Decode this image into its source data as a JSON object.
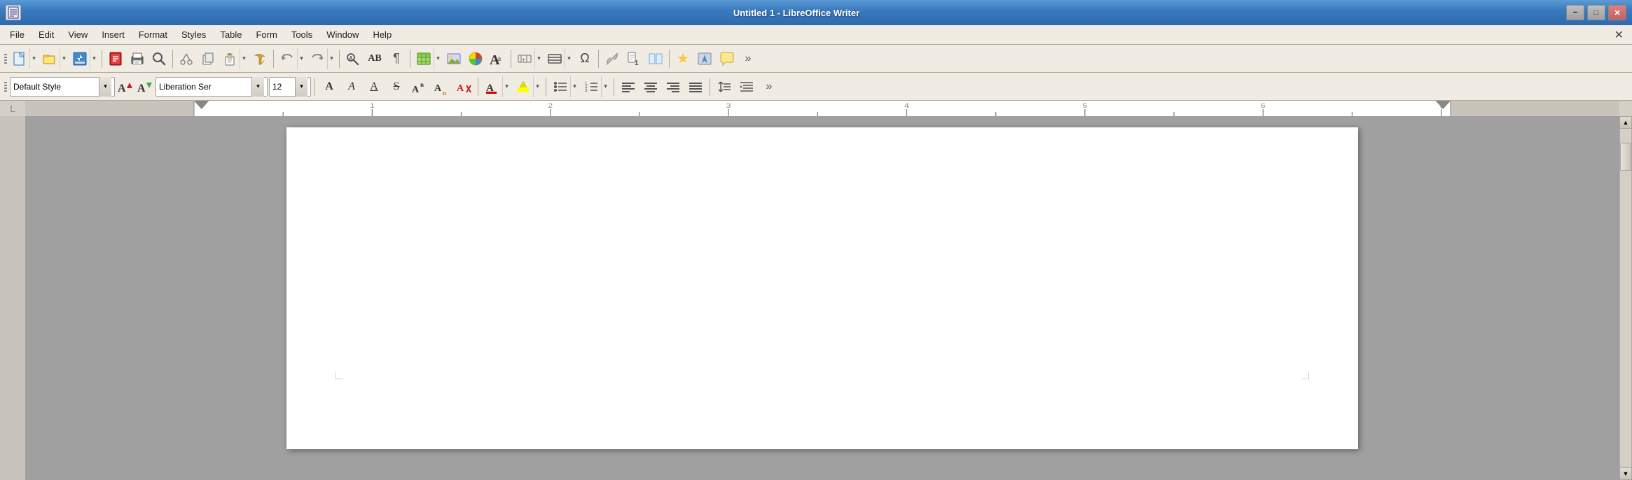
{
  "titleBar": {
    "title": "Untitled 1 - LibreOffice Writer",
    "icon": "≡",
    "minimizeLabel": "−",
    "maximizeLabel": "□",
    "closeLabel": "✕"
  },
  "menuBar": {
    "items": [
      "File",
      "Edit",
      "View",
      "Insert",
      "Format",
      "Styles",
      "Table",
      "Form",
      "Tools",
      "Window",
      "Help"
    ],
    "closeBtn": "✕"
  },
  "toolbar": {
    "more": "»"
  },
  "formatToolbar": {
    "styleLabel": "Default Style",
    "fontLabel": "Liberation Ser",
    "sizeLabel": "12",
    "more": "»"
  },
  "colors": {
    "titleBarTop": "#5b9bd5",
    "titleBarBottom": "#2e6aad",
    "menuBg": "#f0ece4",
    "toolbarBg": "#f0ece4",
    "docBg": "#a0a0a0",
    "pageBg": "#ffffff",
    "accentRed": "#cc0000",
    "accentYellow": "#ffff00"
  }
}
